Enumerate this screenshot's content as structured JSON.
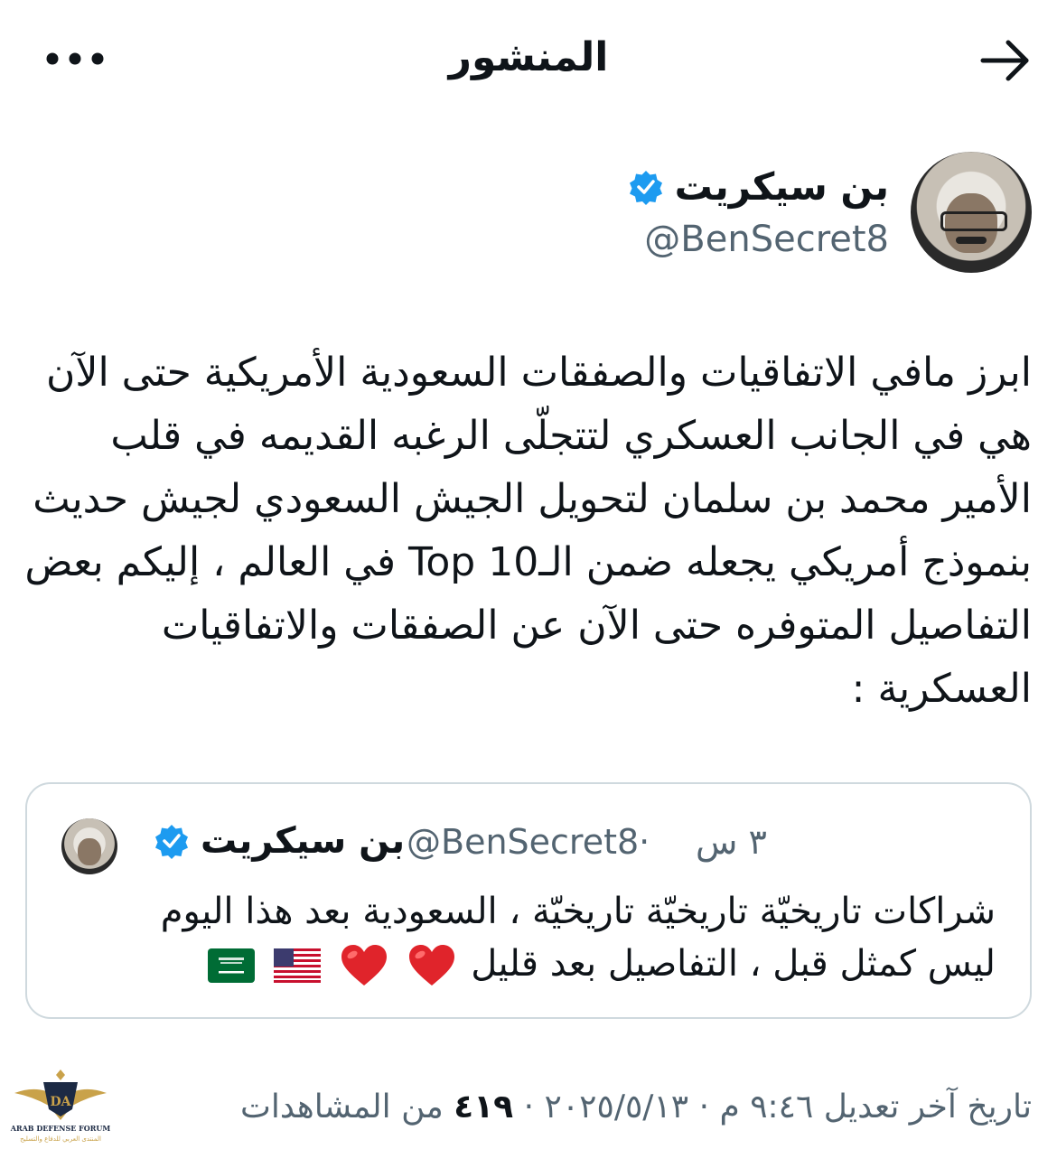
{
  "header": {
    "title": "المنشور",
    "back_icon": "arrow-right-icon",
    "more_icon": "more-horizontal-icon"
  },
  "author": {
    "name": "بن سيكريت",
    "handle": "@BenSecret8",
    "verified": true
  },
  "tweet": {
    "text": "ابرز مافي الاتفاقيات والصفقات السعودية الأمريكية حتى الآن هي في الجانب العسكري لتتجلّى الرغبه القديمه في قلب الأمير محمد بن سلمان لتحويل الجيش السعودي لجيش حديث بنموذج أمريكي يجعله ضمن الـTop 10 في العالم ، إليكم بعض التفاصيل المتوفره حتى الآن عن الصفقات والاتفاقيات العسكرية :"
  },
  "quote": {
    "name": "بن سيكريت",
    "handle": "@BenSecret8",
    "separator": "·",
    "time": "٣ س",
    "line1": "شراكات تاريخيّة تاريخيّة تاريخيّة ، السعودية بعد هذا اليوم",
    "line2": "ليس كمثل قبل ، التفاصيل بعد قليل",
    "emojis": [
      "red-heart",
      "red-heart",
      "us-flag",
      "saudi-flag"
    ]
  },
  "meta": {
    "edited_label": "تاريخ آخر تعديل",
    "time": "٩:٤٦ م",
    "date": "٢٠٢٥/٥/١٣",
    "views_count": "٤١٩",
    "views_label": "من المشاهدات",
    "dot": "·"
  },
  "watermark": {
    "brand": "ARAB DEFENSE FORUM",
    "brand_ar": "المنتدى العربي للدفاع والتسليح",
    "logo_letters": "DA"
  },
  "colors": {
    "text": "#0f1419",
    "secondary": "#536471",
    "verified": "#1d9bf0",
    "border": "#cfd9de",
    "heart": "#e0242b"
  }
}
